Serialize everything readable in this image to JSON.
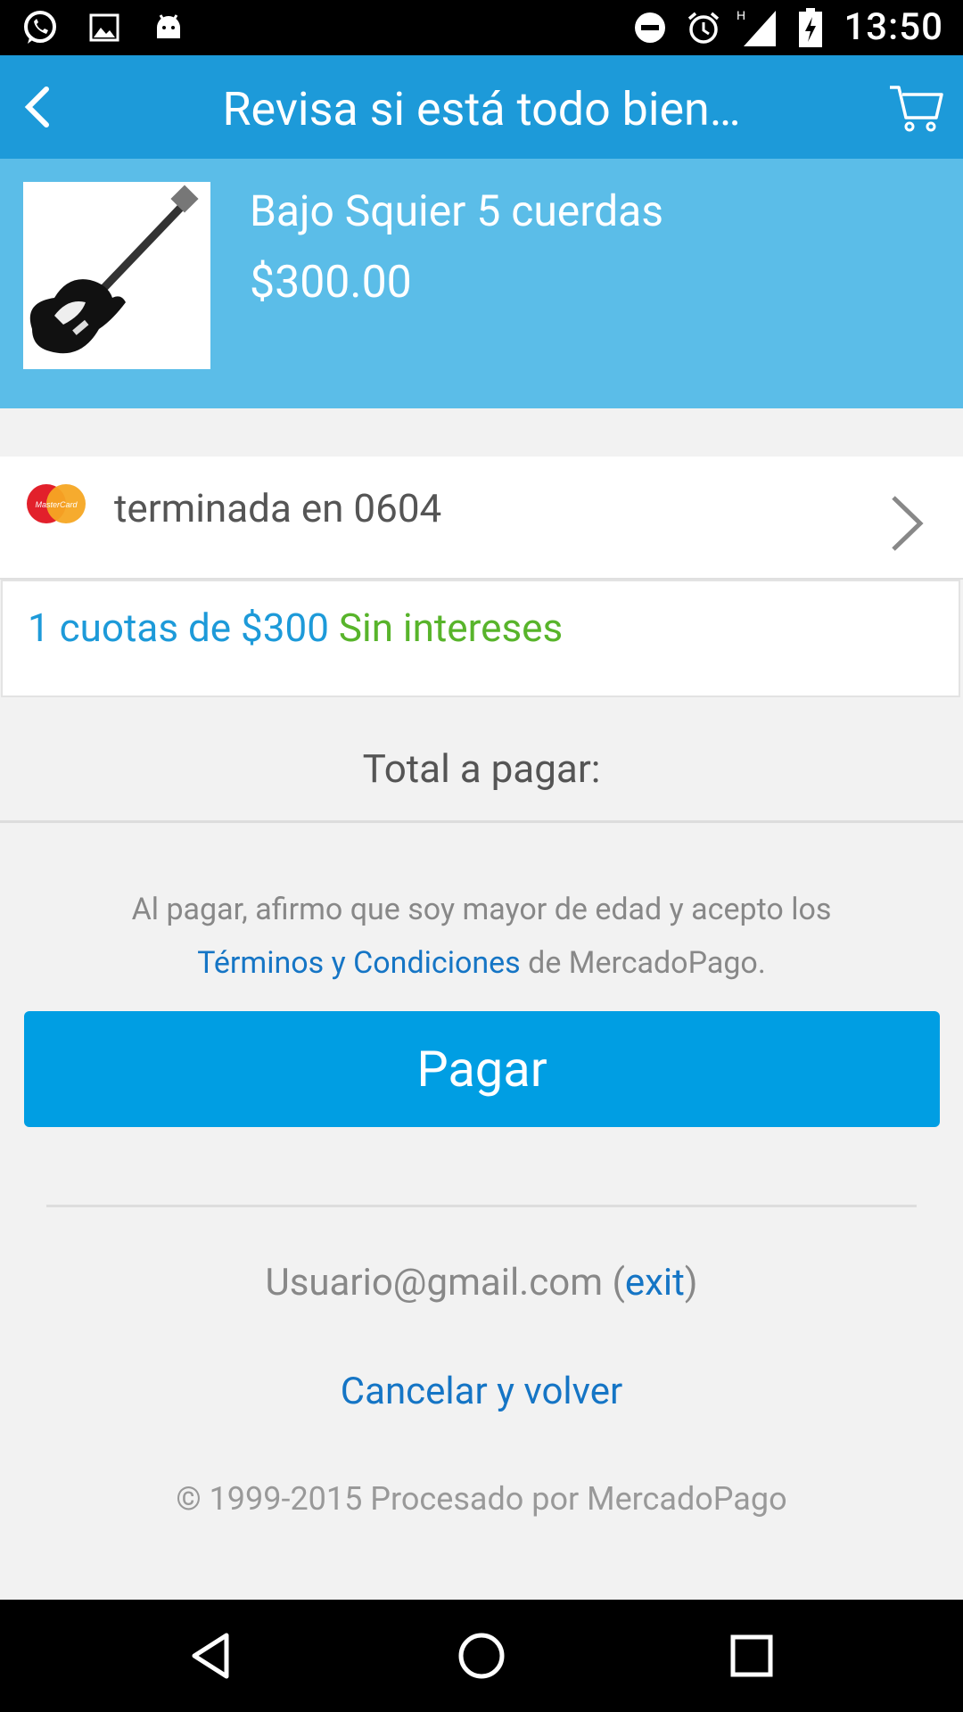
{
  "status_bar": {
    "time": "13:50",
    "network": "H",
    "left_icons": [
      "whatsapp-icon",
      "gallery-icon",
      "android-icon"
    ],
    "right_icons": [
      "dnd-icon",
      "alarm-icon",
      "signal-icon",
      "battery-icon"
    ]
  },
  "app_bar": {
    "title": "Revisa si está todo bien…",
    "back_icon": "back-arrow-icon",
    "cart_icon": "cart-icon",
    "color": "#1d9ad9"
  },
  "product": {
    "name": "Bajo Squier 5 cuerdas",
    "price": "$300.00",
    "background": "#5bbde8"
  },
  "payment_method": {
    "brand": "MasterCard",
    "label": "terminada en 0604"
  },
  "installments": {
    "text": "1 cuotas de $300",
    "interest": "Sin intereses"
  },
  "total": {
    "label": "Total a pagar:"
  },
  "terms": {
    "prefix": "Al pagar, afirmo que soy mayor de edad y acepto los",
    "link": "Términos y Condiciones",
    "suffix": "de MercadoPago."
  },
  "pay_button": {
    "label": "Pagar",
    "color": "#009ee3"
  },
  "account": {
    "email": "Usuario@gmail.com",
    "open_paren": " (",
    "exit_label": "exit",
    "close_paren": ")"
  },
  "cancel": {
    "label": "Cancelar y volver"
  },
  "footer": {
    "copyright": "© 1999-2015 Procesado por MercadoPago"
  },
  "nav_bar": {
    "buttons": [
      "back-nav-icon",
      "home-nav-icon",
      "recents-nav-icon"
    ]
  }
}
